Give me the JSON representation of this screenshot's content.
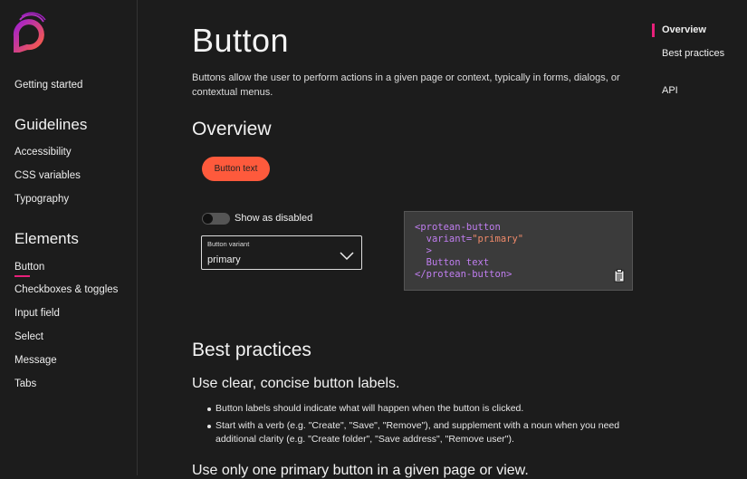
{
  "sidebar": {
    "getting_started": "Getting started",
    "guidelines_heading": "Guidelines",
    "guidelines": [
      "Accessibility",
      "CSS variables",
      "Typography"
    ],
    "elements_heading": "Elements",
    "elements": [
      "Button",
      "Checkboxes & toggles",
      "Input field",
      "Select",
      "Message",
      "Tabs"
    ],
    "active": "Button"
  },
  "main": {
    "title": "Button",
    "intro": "Buttons allow the user to perform actions in a given page or context, typically in forms, dialogs, or contextual menus.",
    "overview_heading": "Overview",
    "demo_button_label": "Button text",
    "toggle_label": "Show as disabled",
    "toggle_on": false,
    "select_label": "Button variant",
    "select_value": "primary",
    "code": {
      "open_tag": "<protean-button",
      "attr_name": "  variant=",
      "attr_value": "\"primary\"",
      "close_bracket": "  >",
      "content": "  Button text",
      "end_tag": "</protean-button>"
    },
    "best_practices_heading": "Best practices",
    "bp1_heading": "Use clear, concise button labels.",
    "bp1_items": [
      "Button labels should indicate what will happen when the button is clicked.",
      "Start with a verb (e.g. \"Create\", \"Save\", \"Remove\"), and supplement with a noun when you need additional clarity (e.g. \"Create folder\", \"Save address\", \"Remove user\")."
    ],
    "bp2_heading": "Use only one primary button in a given page or view."
  },
  "toc": {
    "items": [
      "Overview",
      "Best practices",
      "API"
    ],
    "active": "Overview"
  },
  "colors": {
    "accent": "#e8207a",
    "primary_button": "#fe5a3c",
    "background": "#1c1c1c"
  }
}
